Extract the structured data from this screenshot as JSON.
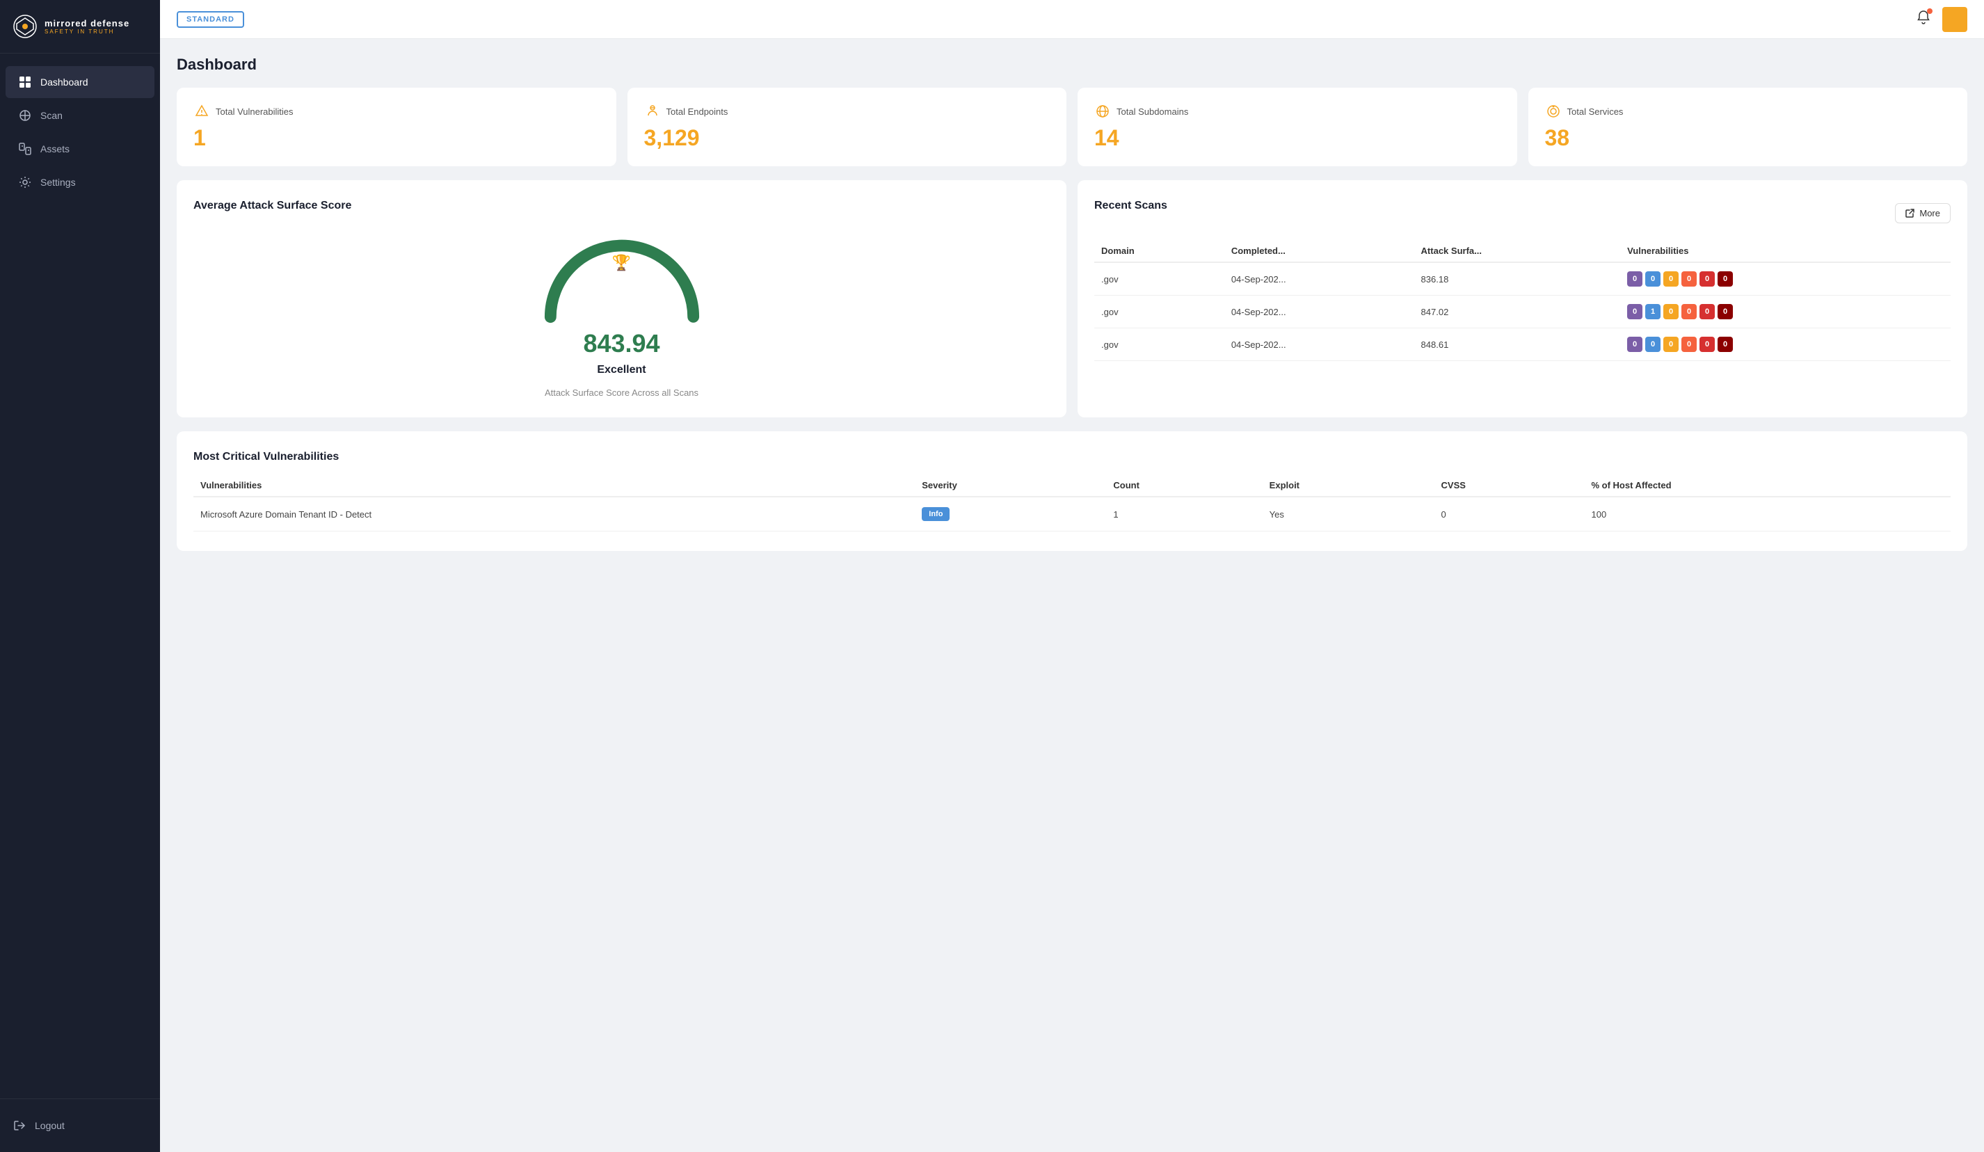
{
  "sidebar": {
    "logo_title": "mirrored defense",
    "logo_subtitle": "SAFETY IN TRUTH",
    "nav_items": [
      {
        "id": "dashboard",
        "label": "Dashboard",
        "active": true
      },
      {
        "id": "scan",
        "label": "Scan",
        "active": false
      },
      {
        "id": "assets",
        "label": "Assets",
        "active": false
      },
      {
        "id": "settings",
        "label": "Settings",
        "active": false
      }
    ],
    "logout_label": "Logout"
  },
  "topbar": {
    "badge_label": "STANDARD"
  },
  "page": {
    "title": "Dashboard"
  },
  "stats": [
    {
      "id": "vulnerabilities",
      "label": "Total Vulnerabilities",
      "value": "1"
    },
    {
      "id": "endpoints",
      "label": "Total Endpoints",
      "value": "3,129"
    },
    {
      "id": "subdomains",
      "label": "Total Subdomains",
      "value": "14"
    },
    {
      "id": "services",
      "label": "Total Services",
      "value": "38"
    }
  ],
  "score_card": {
    "title": "Average Attack Surface Score",
    "score": "843.94",
    "label": "Excellent",
    "sub_label": "Attack Surface Score Across all Scans"
  },
  "recent_scans": {
    "title": "Recent Scans",
    "more_label": "More",
    "columns": [
      "Domain",
      "Completed...",
      "Attack Surfa...",
      "Vulnerabilities"
    ],
    "rows": [
      {
        "domain": ".gov",
        "completed": "04-Sep-202...",
        "attack_surface": "836.18",
        "badges": [
          0,
          0,
          0,
          0,
          0,
          0
        ]
      },
      {
        "domain": ".gov",
        "completed": "04-Sep-202...",
        "attack_surface": "847.02",
        "badges": [
          0,
          1,
          0,
          0,
          0,
          0
        ]
      },
      {
        "domain": ".gov",
        "completed": "04-Sep-202...",
        "attack_surface": "848.61",
        "badges": [
          0,
          0,
          0,
          0,
          0,
          0
        ]
      }
    ]
  },
  "vuln_section": {
    "title": "Most Critical Vulnerabilities",
    "columns": [
      "Vulnerabilities",
      "Severity",
      "Count",
      "Exploit",
      "CVSS",
      "% of Host Affected"
    ],
    "rows": [
      {
        "name": "Microsoft Azure Domain Tenant ID - Detect",
        "severity": "Info",
        "count": "1",
        "exploit": "Yes",
        "cvss": "0",
        "host_affected": "100"
      }
    ]
  }
}
